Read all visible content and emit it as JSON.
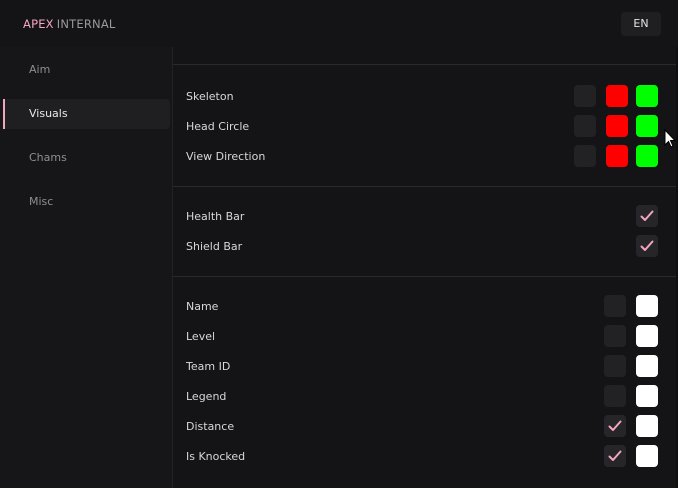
{
  "header": {
    "brand_primary": "APEX",
    "brand_secondary": "INTERNAL",
    "language": "EN"
  },
  "sidebar": {
    "items": [
      {
        "label": "Aim",
        "active": false
      },
      {
        "label": "Visuals",
        "active": true
      },
      {
        "label": "Chams",
        "active": false
      },
      {
        "label": "Misc",
        "active": false
      }
    ]
  },
  "colors": {
    "accent": "#f4a6bd",
    "red": "#ff0000",
    "green": "#00ff00",
    "white": "#ffffff",
    "swatch_off": "#222225"
  },
  "sections": {
    "bones": {
      "rows": [
        {
          "label": "Skeleton",
          "swatches": [
            "off",
            "red",
            "green"
          ]
        },
        {
          "label": "Head Circle",
          "swatches": [
            "off",
            "red",
            "green"
          ]
        },
        {
          "label": "View Direction",
          "swatches": [
            "off",
            "red",
            "green"
          ]
        }
      ]
    },
    "bars": {
      "rows": [
        {
          "label": "Health Bar",
          "checked": true
        },
        {
          "label": "Shield Bar",
          "checked": true
        }
      ]
    },
    "info": {
      "rows": [
        {
          "label": "Name",
          "checked": false,
          "color": "white"
        },
        {
          "label": "Level",
          "checked": false,
          "color": "white"
        },
        {
          "label": "Team ID",
          "checked": false,
          "color": "white"
        },
        {
          "label": "Legend",
          "checked": false,
          "color": "white"
        },
        {
          "label": "Distance",
          "checked": true,
          "color": "white"
        },
        {
          "label": "Is Knocked",
          "checked": true,
          "color": "white"
        }
      ]
    }
  }
}
